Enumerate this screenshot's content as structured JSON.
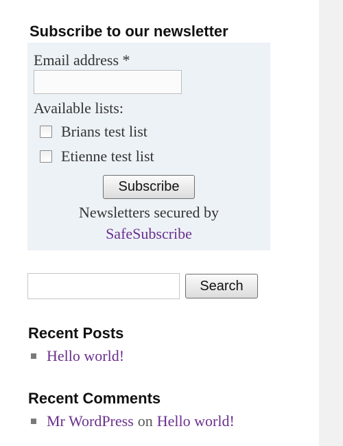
{
  "newsletter": {
    "title": "Subscribe to our newsletter",
    "email_label": "Email address *",
    "email_value": "",
    "lists_label": "Available lists:",
    "lists": [
      {
        "label": "Brians test list",
        "checked": false
      },
      {
        "label": "Etienne test list",
        "checked": false
      }
    ],
    "subscribe_label": "Subscribe",
    "secured_text": "Newsletters secured by",
    "secured_link": "SafeSubscribe"
  },
  "search": {
    "value": "",
    "button_label": "Search"
  },
  "recent_posts": {
    "title": "Recent Posts",
    "items": [
      {
        "label": "Hello world!"
      }
    ]
  },
  "recent_comments": {
    "title": "Recent Comments",
    "items": [
      {
        "author": "Mr WordPress",
        "connector": "on",
        "post": "Hello world!"
      }
    ]
  },
  "colors": {
    "link": "#6a2f8e",
    "box_background": "#edf2f7",
    "gutter": "#f1f1f1"
  }
}
